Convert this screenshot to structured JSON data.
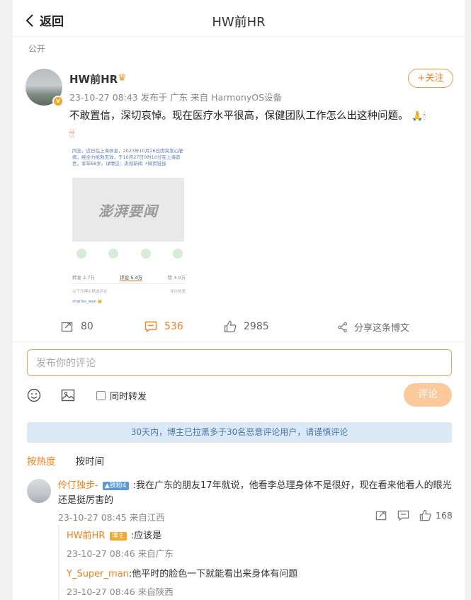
{
  "header": {
    "back_label": "返回",
    "title": "HW前HR"
  },
  "post": {
    "visibility": "公开",
    "author": "HW前HR",
    "meta": "23-10-27 08:43  发布于 广东  来自 HarmonyOS设备",
    "follow_label": "+关注",
    "text": "不敢置信，深切哀悼。现在医疗水平很高，保健团队工作怎么出这种问题。",
    "image": {
      "article_text": "同志，近日在上海休息，2023年10月26日因突发心脏病，经全力抢救无效，于10月27日0时10分在上海逝世，享年68岁。详情见：央视新闻 ↗网页链接",
      "watermark": "澎湃要闻",
      "stats": {
        "repost": "转发 2.7万",
        "comment": "评论 5.4万",
        "like": "赞 4.9万"
      },
      "note_left": "以下为博主精选评论",
      "note_right": "评论热度",
      "commenter": "charles_wan 👑"
    }
  },
  "actions": {
    "repost_count": "80",
    "comment_count": "536",
    "like_count": "2985",
    "share_label": "分享这条博文"
  },
  "composer": {
    "placeholder": "发布你的评论",
    "repost_label": "同时转发",
    "send_label": "评论"
  },
  "notice": "30天内，博主已拉黑多于30名恶意评论用户，请谨慎评论",
  "sort": {
    "hot": "按热度",
    "time": "按时间"
  },
  "comments": [
    {
      "user": "伶仃独步-",
      "badge": "铁粉4",
      "text": ":我在广东的朋友17年就说，他看李总理身体不是很好，现在看来他看人的眼光还是挺厉害的",
      "time": "23-10-27 08:45 来自江西",
      "likes": "168",
      "replies": [
        {
          "user": "HW前HR",
          "badge": "博主",
          "text": ":应该是",
          "time": "23-10-27 08:46 来自广东"
        },
        {
          "user": "Y_Super_man",
          "text": ":他平时的脸色一下就能看出来身体有问题",
          "time": "23-10-27 08:46 来自陕西"
        }
      ]
    }
  ],
  "colors": {
    "accent": "#f08020",
    "notice_bg": "#dbe9f6",
    "notice_text": "#4a74a8"
  }
}
